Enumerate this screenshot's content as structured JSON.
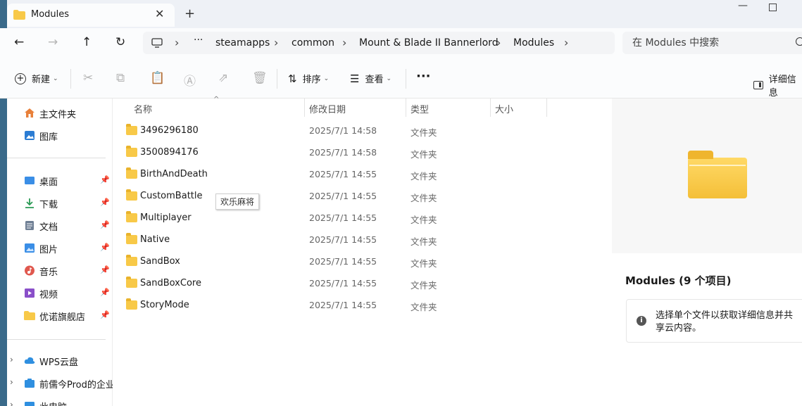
{
  "window": {
    "tab_title": "Modules",
    "new_tab_label": "+"
  },
  "address": {
    "path": [
      "steamapps",
      "common",
      "Mount & Blade II Bannerlord",
      "Modules"
    ],
    "ellipsis": "···",
    "search_placeholder": "在 Modules 中搜索"
  },
  "toolbar": {
    "new_label": "新建",
    "sort_label": "排序",
    "view_label": "查看",
    "more_label": "···",
    "details_label": "详细信息"
  },
  "sidebar": {
    "top_items": [
      {
        "label": "主文件夹",
        "icon": "home-icon",
        "color": "#e8803a"
      },
      {
        "label": "图库",
        "icon": "gallery-icon",
        "color": "#2b7cd3"
      }
    ],
    "pinned_items": [
      {
        "label": "桌面",
        "icon": "desktop-icon",
        "color": "#3a8ee6"
      },
      {
        "label": "下载",
        "icon": "download-icon",
        "color": "#2b9a55"
      },
      {
        "label": "文档",
        "icon": "documents-icon",
        "color": "#6f7f94"
      },
      {
        "label": "图片",
        "icon": "pictures-icon",
        "color": "#3a8ee6"
      },
      {
        "label": "音乐",
        "icon": "music-icon",
        "color": "#e0584e"
      },
      {
        "label": "视频",
        "icon": "video-icon",
        "color": "#8a4fc9"
      },
      {
        "label": "优诺旗舰店",
        "icon": "folder-icon",
        "color": "#f8c948"
      }
    ],
    "bottom_items": [
      {
        "label": "WPS云盘",
        "icon": "cloud-icon",
        "color": "#2f8fe0"
      },
      {
        "label": "前儒今Prod的企业",
        "icon": "enterprise-icon",
        "color": "#2f8fe0"
      },
      {
        "label": "此电脑",
        "icon": "computer-icon",
        "color": "#2f8fe0"
      }
    ]
  },
  "list": {
    "columns": {
      "name": "名称",
      "date": "修改日期",
      "type": "类型",
      "size": "大小"
    },
    "rows": [
      {
        "name": "3496296180",
        "date": "2025/7/1 14:58",
        "type": "文件夹"
      },
      {
        "name": "3500894176",
        "date": "2025/7/1 14:58",
        "type": "文件夹"
      },
      {
        "name": "BirthAndDeath",
        "date": "2025/7/1 14:55",
        "type": "文件夹"
      },
      {
        "name": "CustomBattle",
        "date": "2025/7/1 14:55",
        "type": "文件夹"
      },
      {
        "name": "Multiplayer",
        "date": "2025/7/1 14:55",
        "type": "文件夹"
      },
      {
        "name": "Native",
        "date": "2025/7/1 14:55",
        "type": "文件夹"
      },
      {
        "name": "SandBox",
        "date": "2025/7/1 14:55",
        "type": "文件夹"
      },
      {
        "name": "SandBoxCore",
        "date": "2025/7/1 14:55",
        "type": "文件夹"
      },
      {
        "name": "StoryMode",
        "date": "2025/7/1 14:55",
        "type": "文件夹"
      }
    ],
    "tooltip": "欢乐麻将"
  },
  "details": {
    "title": "Modules (9 个项目)",
    "info": "选择单个文件以获取详细信息并共享云内容。"
  }
}
